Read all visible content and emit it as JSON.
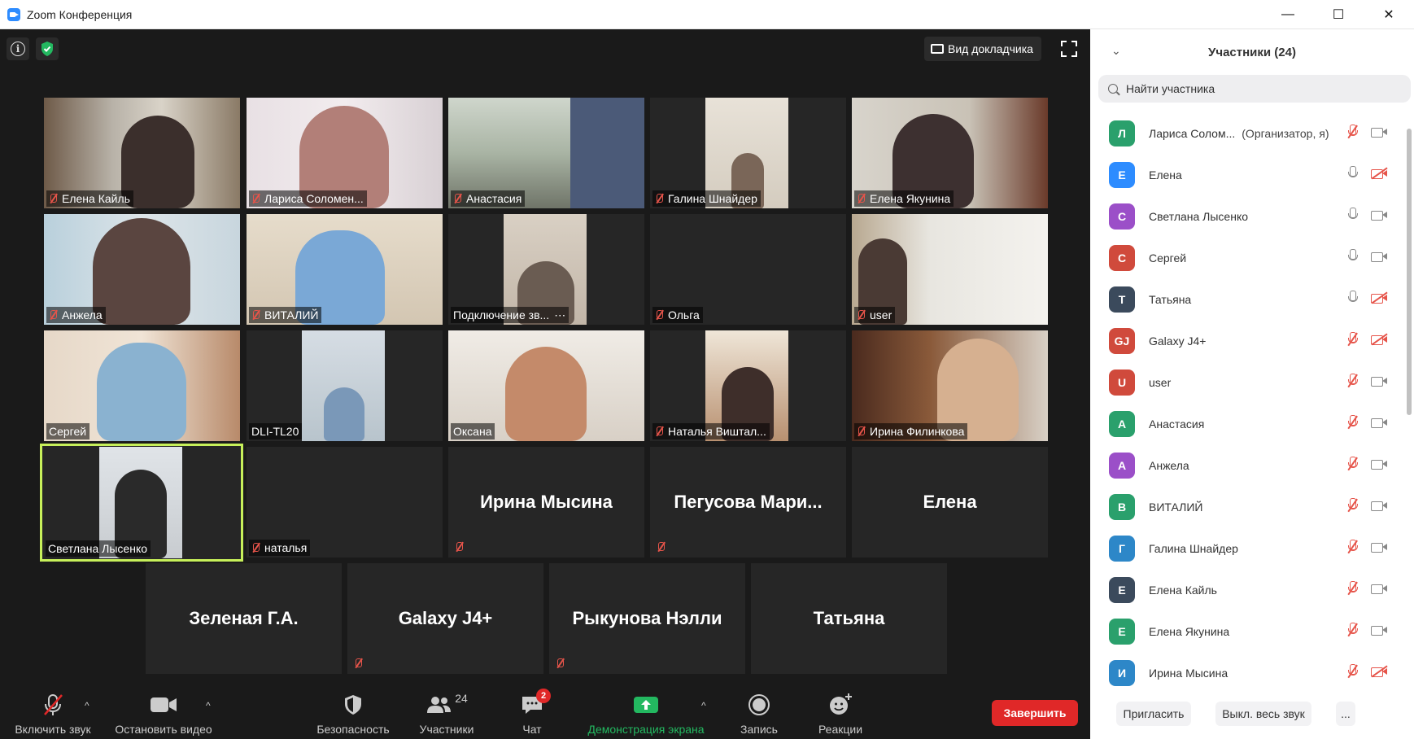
{
  "window": {
    "title": "Zoom Конференция",
    "minimize": "—",
    "maximize": "☐",
    "close": "✕"
  },
  "top": {
    "speaker_view": "Вид докладчика"
  },
  "tiles": [
    {
      "name": "Елена Кайль",
      "muted": true
    },
    {
      "name": "Лариса Соломен...",
      "muted": true
    },
    {
      "name": "Анастасия",
      "muted": true
    },
    {
      "name": "Галина Шнайдер",
      "muted": true
    },
    {
      "name": "Елена Якунина",
      "muted": true
    },
    {
      "name": "Анжела",
      "muted": true
    },
    {
      "name": "ВИТАЛИЙ",
      "muted": true
    },
    {
      "name": "Подключение зв...",
      "muted": false
    },
    {
      "name": "Ольга",
      "muted": true
    },
    {
      "name": "user",
      "muted": true
    },
    {
      "name": "Сергей",
      "muted": false
    },
    {
      "name": "DLI-TL20",
      "muted": false
    },
    {
      "name": "Оксана",
      "muted": false
    },
    {
      "name": "Наталья Виштал...",
      "muted": true
    },
    {
      "name": "Ирина Филинкова",
      "muted": true
    },
    {
      "name": "Светлана Лысенко",
      "muted": false
    },
    {
      "name": "наталья",
      "muted": true
    },
    {
      "name": "Ирина Мысина",
      "muted": true
    },
    {
      "name": "Пегусова  Мари...",
      "muted": true
    },
    {
      "name": "Елена",
      "muted": false
    },
    {
      "name": "Зеленая Г.А.",
      "muted": false
    },
    {
      "name": "Galaxy J4+",
      "muted": true
    },
    {
      "name": "Рыкунова Нэлли",
      "muted": true
    },
    {
      "name": "Татьяна",
      "muted": false
    }
  ],
  "toolbar": {
    "unmute": "Включить звук",
    "stop_video": "Остановить видео",
    "security": "Безопасность",
    "participants": "Участники",
    "participants_count": "24",
    "chat": "Чат",
    "chat_badge": "2",
    "share": "Демонстрация экрана",
    "record": "Запись",
    "reactions": "Реакции",
    "end": "Завершить",
    "caret": "^"
  },
  "panel": {
    "title": "Участники (24)",
    "search_placeholder": "Найти участника",
    "participants": [
      {
        "initials": "Л",
        "name": "Лариса Солом...",
        "role": "(Организатор, я)",
        "color": "#2aa06c",
        "mic": "off",
        "cam": "on"
      },
      {
        "initials": "Е",
        "name": "Елена",
        "role": "",
        "color": "#2d8cff",
        "mic": "on",
        "cam": "off"
      },
      {
        "initials": "С",
        "name": "Светлана Лысенко",
        "role": "",
        "color": "#9b4fc8",
        "mic": "on",
        "cam": "on"
      },
      {
        "initials": "С",
        "name": "Сергей",
        "role": "",
        "color": "#d04a3c",
        "mic": "on",
        "cam": "on"
      },
      {
        "initials": "Т",
        "name": "Татьяна",
        "role": "",
        "color": "#3b4a5c",
        "mic": "on",
        "cam": "off"
      },
      {
        "initials": "GJ",
        "name": "Galaxy J4+",
        "role": "",
        "color": "#d04a3c",
        "mic": "off",
        "cam": "off"
      },
      {
        "initials": "U",
        "name": "user",
        "role": "",
        "color": "#d04a3c",
        "mic": "off",
        "cam": "on"
      },
      {
        "initials": "А",
        "name": "Анастасия",
        "role": "",
        "color": "#2aa06c",
        "mic": "off",
        "cam": "on"
      },
      {
        "initials": "А",
        "name": "Анжела",
        "role": "",
        "color": "#9b4fc8",
        "mic": "off",
        "cam": "on"
      },
      {
        "initials": "В",
        "name": "ВИТАЛИЙ",
        "role": "",
        "color": "#2aa06c",
        "mic": "off",
        "cam": "on"
      },
      {
        "initials": "Г",
        "name": "Галина Шнайдер",
        "role": "",
        "color": "#2d87c8",
        "mic": "off",
        "cam": "on"
      },
      {
        "initials": "Е",
        "name": "Елена Кайль",
        "role": "",
        "color": "#3b4a5c",
        "mic": "off",
        "cam": "on"
      },
      {
        "initials": "Е",
        "name": "Елена Якунина",
        "role": "",
        "color": "#2aa06c",
        "mic": "off",
        "cam": "on"
      },
      {
        "initials": "И",
        "name": "Ирина Мысина",
        "role": "",
        "color": "#2d87c8",
        "mic": "off",
        "cam": "off"
      }
    ],
    "invite": "Пригласить",
    "mute_all": "Выкл. весь звук",
    "more": "..."
  }
}
